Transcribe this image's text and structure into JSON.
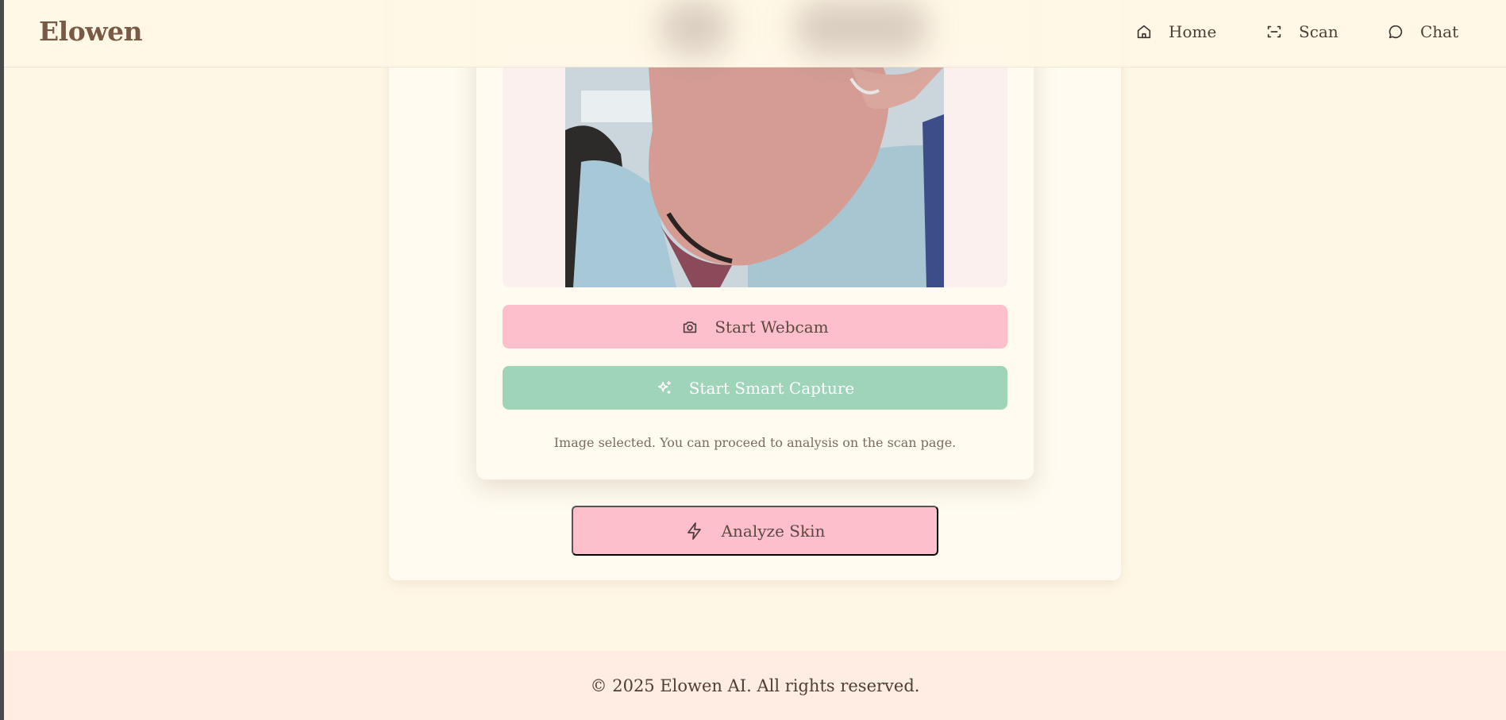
{
  "header": {
    "logo": "Elowen",
    "nav": [
      {
        "label": "Home",
        "icon": "home-icon"
      },
      {
        "label": "Scan",
        "icon": "scan-icon"
      },
      {
        "label": "Chat",
        "icon": "chat-icon"
      }
    ]
  },
  "capture": {
    "preview_alt": "webcam preview",
    "webcam_button": "Start Webcam",
    "smart_capture_button": "Start Smart Capture",
    "status": "Image selected. You can proceed to analysis on the scan page."
  },
  "analyze_button": "Analyze Skin",
  "footer": {
    "copyright": "© 2025 Elowen AI. All rights reserved."
  },
  "colors": {
    "background": "#fff7e6",
    "pink_button": "#fdbfcc",
    "green_button": "#9fd4b9",
    "footer_bg": "#ffece3",
    "logo": "#7a5a44"
  }
}
